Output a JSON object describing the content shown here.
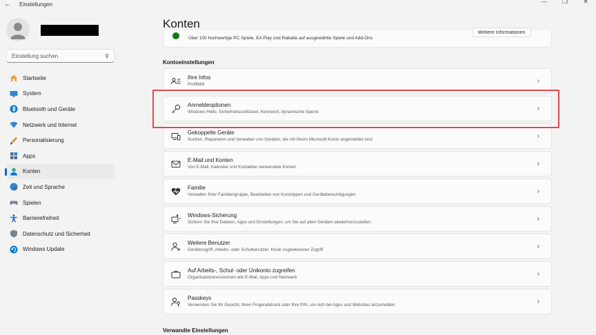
{
  "window": {
    "app_title": "Einstellungen",
    "back_icon": "back-arrow-icon",
    "controls": [
      "minimize-icon",
      "maximize-icon",
      "close-icon"
    ]
  },
  "sidebar": {
    "search_placeholder": "Einstellung suchen",
    "items": [
      {
        "label": "Startseite",
        "icon": "home-icon",
        "color": "#e8a33d"
      },
      {
        "label": "System",
        "icon": "monitor-icon",
        "color": "#2b88d8"
      },
      {
        "label": "Bluetooth und Geräte",
        "icon": "bluetooth-icon",
        "color": "#0078d4"
      },
      {
        "label": "Netzwerk und Internet",
        "icon": "wifi-icon",
        "color": "#2b88d8"
      },
      {
        "label": "Personalisierung",
        "icon": "brush-icon",
        "color": "#e08a2c"
      },
      {
        "label": "Apps",
        "icon": "apps-icon",
        "color": "#5b6b85"
      },
      {
        "label": "Konten",
        "icon": "person-icon",
        "color": "#2eaa8b",
        "active": true
      },
      {
        "label": "Zeit und Sprache",
        "icon": "globe-clock-icon",
        "color": "#2b88d8"
      },
      {
        "label": "Spielen",
        "icon": "gamepad-icon",
        "color": "#7a8491"
      },
      {
        "label": "Barrierefreiheit",
        "icon": "accessibility-icon",
        "color": "#1d6fc9"
      },
      {
        "label": "Datenschutz und Sicherheit",
        "icon": "shield-icon",
        "color": "#7a8491"
      },
      {
        "label": "Windows Update",
        "icon": "update-icon",
        "color": "#0078d4"
      }
    ]
  },
  "main": {
    "title": "Konten",
    "promo": {
      "text": "Über 100 hochwertige PC-Spiele, EA Play und Rabatte auf ausgewählte Spiele und Add-Ons",
      "button": "Weitere Informationen"
    },
    "section_account": "Kontoeinstellungen",
    "cards": [
      {
        "title": "Ihre Infos",
        "sub": "Profilbild",
        "icon": "person-card-icon"
      },
      {
        "title": "Anmeldeoptionen",
        "sub": "Windows Hello, Sicherheitsschlüssel, Kennwort, dynamische Sperre",
        "icon": "key-icon"
      },
      {
        "title": "Gekoppelte Geräte",
        "sub": "Suchen, Reparieren und Verwalten von Geräten, die mit Ihrem Microsoft-Konto angemeldet sind",
        "icon": "devices-icon"
      },
      {
        "title": "E-Mail und Konten",
        "sub": "Von E-Mail, Kalender und Kontakten verwendete Konten",
        "icon": "mail-icon"
      },
      {
        "title": "Familie",
        "sub": "Verwalten Ihrer Familiengruppe, Bearbeiten von Kontotypen und Geräteberechtigungen",
        "icon": "family-heart-icon"
      },
      {
        "title": "Windows-Sicherung",
        "sub": "Sichern Sie Ihre Dateien, Apps und Einstellungen, um Sie auf allen Geräten wiederherzustellen.",
        "icon": "backup-icon"
      },
      {
        "title": "Weitere Benutzer",
        "sub": "Gerätezugriff, Arbeits- oder Schulbenutzer, Kiosk zugewiesener Zugriff",
        "icon": "add-user-icon"
      },
      {
        "title": "Auf Arbeits-, Schul- oder Unikonto zugreifen",
        "sub": "Organisationsressourcen wie E-Mail, Apps und Netzwerk",
        "icon": "briefcase-icon"
      },
      {
        "title": "Passkeys",
        "sub": "Verwenden Sie Ihr Gesicht, Ihren Fingerabdruck oder Ihre PIN, um sich bei Apps und Websites anzumelden",
        "icon": "passkey-icon"
      }
    ],
    "section_related": "Verwandte Einstellungen"
  }
}
